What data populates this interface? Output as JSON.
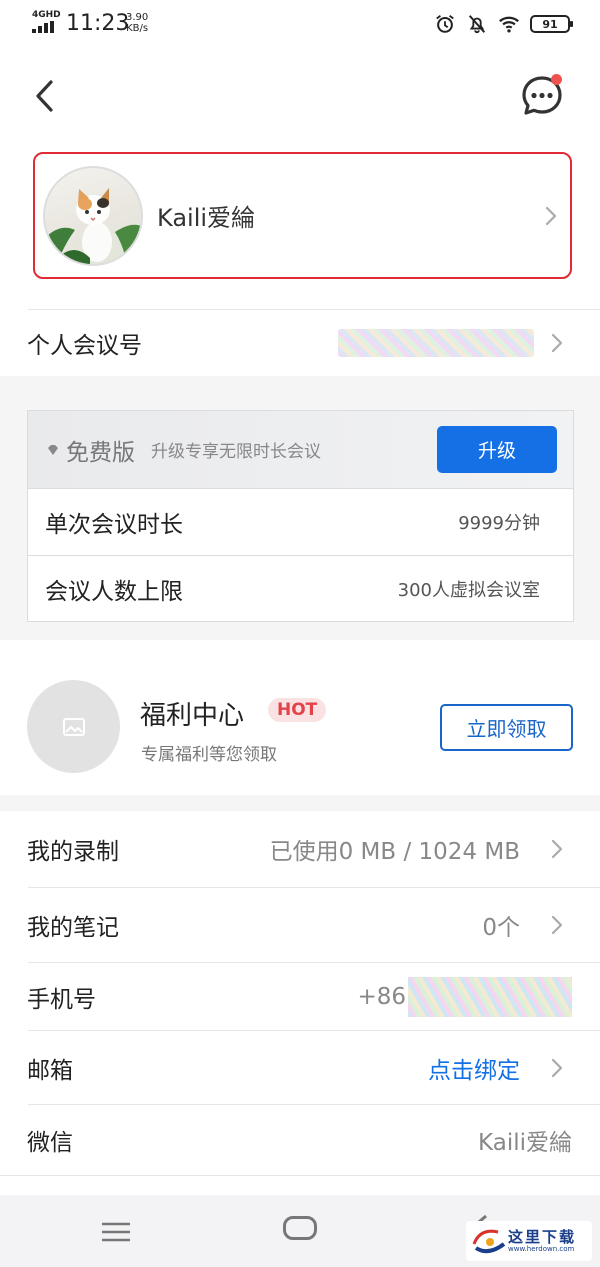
{
  "status_bar": {
    "network": "4GHD",
    "time": "11:23",
    "speed_value": "3.90",
    "speed_unit": "KB/s",
    "battery": "91",
    "icons": [
      "alarm-icon",
      "mute-icon",
      "wifi-icon",
      "battery-icon"
    ]
  },
  "header": {
    "back_icon": "chevron-left-icon",
    "message_icon": "chat-bubble-icon",
    "has_notification_dot": true
  },
  "profile": {
    "name": "Kaili爱綸"
  },
  "personal_meeting": {
    "label": "个人会议号"
  },
  "plan": {
    "tier": "免费版",
    "description": "升级专享无限时长会议",
    "upgrade_label": "升级",
    "rows": [
      {
        "label": "单次会议时长",
        "value": "9999分钟"
      },
      {
        "label": "会议人数上限",
        "value": "300人虚拟会议室"
      }
    ]
  },
  "welfare": {
    "title": "福利中心",
    "badge": "HOT",
    "subtitle": "专属福利等您领取",
    "claim_label": "立即领取"
  },
  "list": {
    "recording": {
      "label": "我的录制",
      "value": "已使用0 MB / 1024 MB"
    },
    "notes": {
      "label": "我的笔记",
      "value": "0个"
    },
    "phone": {
      "label": "手机号",
      "value": "+86"
    },
    "email": {
      "label": "邮箱",
      "value": "点击绑定"
    },
    "wechat": {
      "label": "微信",
      "value": "Kaili爱綸"
    }
  },
  "watermark": {
    "text": "这里下载",
    "url": "www.herdown.com"
  },
  "colors": {
    "accent_blue": "#1570e6",
    "highlight_red": "#e02a36",
    "hot_red": "#e2434a"
  }
}
